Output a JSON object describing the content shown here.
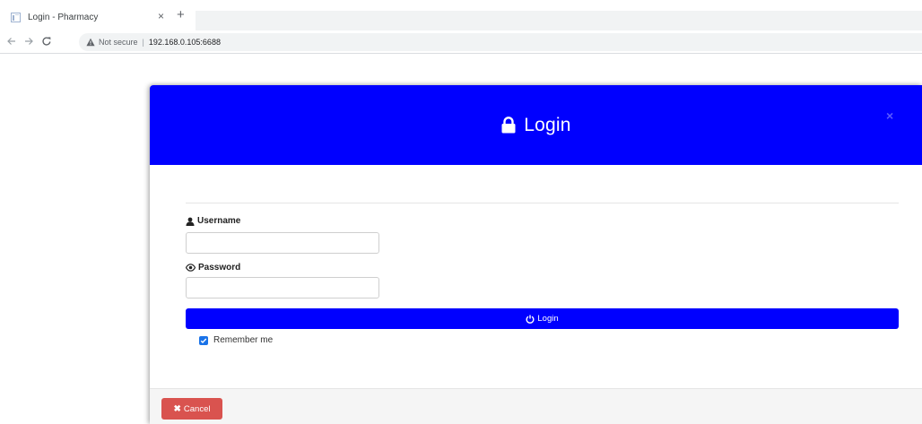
{
  "browser": {
    "tab_title": "Login - Pharmacy",
    "tab_close": "×",
    "new_tab": "+",
    "not_secure": "Not secure",
    "separator": "|",
    "url": "192.168.0.105:6688"
  },
  "modal": {
    "title": "Login",
    "close": "×",
    "username_label": "Username",
    "username_value": "",
    "password_label": "Password",
    "password_value": "",
    "login_button": "Login",
    "remember_label": "Remember me",
    "remember_checked": true,
    "cancel_button": "Cancel",
    "cancel_glyph": "✖"
  },
  "colors": {
    "header_bg": "#0000ff",
    "primary_button": "#0000ff",
    "danger_button": "#d9534f",
    "checkbox": "#1a73e8"
  },
  "icons": {
    "tab": "page-favicon-icon",
    "back": "back-arrow-icon",
    "forward": "forward-arrow-icon",
    "reload": "reload-icon",
    "security": "warning-triangle-icon",
    "title": "lock-icon",
    "username": "user-icon",
    "password": "eye-icon",
    "login": "power-icon",
    "cancel": "x-icon"
  }
}
